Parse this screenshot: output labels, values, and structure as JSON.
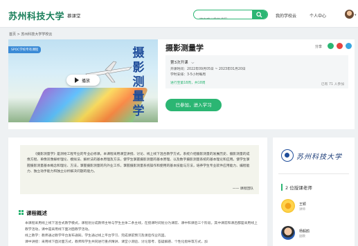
{
  "header": {
    "logo": "苏州科技大学",
    "nav_mooc": "慕课堂",
    "search_placeholder": "搜索感兴趣的课程",
    "my_school": "我的学校云",
    "personal_center": "个人中心",
    "avatar_caret": "▾"
  },
  "breadcrumb": "首页 > 苏州科技大学学校云",
  "course": {
    "badge": "SPOC学校专有课程",
    "cover_title": "摄影测量学",
    "play_label": "播放",
    "title": "摄影测量学",
    "share_label": "分享",
    "term": "第3次开课",
    "term_caret": "⌵",
    "dates": "开课时间：2022年09月05日 ~ 2023年01月20日",
    "workload": "学时安排：3-5小时每周",
    "progress": "进行至第18周，共18周",
    "enrolled": "已有 71 人参加",
    "join_label": "已参加，进入学习"
  },
  "intro": {
    "quote": "《摄影测量学》是测绘工程专业的专业必修课。本课程采用课堂讲授、讨论、线上线下混合教学方式，系统介绍摄影测量的发展历史、摄影测量的成像方程、单像双像解析理论、模拟法、解析法的基本原理及方法，使学生掌握摄影测量的基本原理、以及数字摄影测量系统的基本理论和应用。使学生掌握摄影测量基本概念和理论、方法，掌握摄影测量的内外业工作，掌握摄影测量系统操作和使用的基本技能与方法，培养学生专业软件应用能力、编程能力、独立动手能力和独立分析解决问题的能力。",
    "signature": "—— 课程团队",
    "overview_title": "课程概述",
    "overview_lines": [
      "本课程采用线上线下混合式教学模式，课程划分成教师主导与学生主体二条主线，在授课时间划分为课前、课中和课后三个阶段，其中课前和课后都是采用线上教学活动，课中是采用线下面对面教学活动。",
      "线上教学：教师通过教学平台发布通知，学生通过线上平台学习、完成课前预习及课后作业巩固。",
      "课中讲授：采用线下面对面方式，教师和学生共同进行重点精讲、课堂小测验、讨论思考、答疑解惑、个性化指导等方式，加"
    ]
  },
  "sidebar": {
    "school_name": "苏州科技大学",
    "teachers_heading": "2 位授课老师",
    "teachers": [
      {
        "name": "王颖",
        "role": "讲师"
      },
      {
        "name": "杨毅鸥",
        "role": "副教"
      }
    ]
  },
  "colors": {
    "brand_green": "#2bb673",
    "share_wechat": "#2bb673",
    "share_weibo": "#e64340",
    "share_qq": "#3aa7e0"
  }
}
